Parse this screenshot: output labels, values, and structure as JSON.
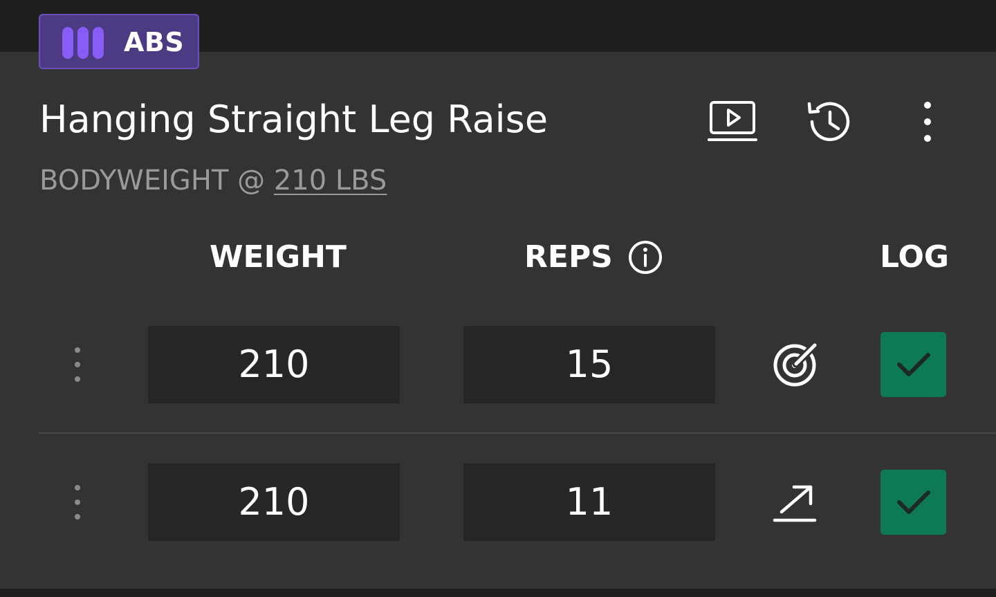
{
  "muscle_badge": {
    "label": "ABS",
    "icon": "bars-icon",
    "color": "#4c3a82",
    "accent": "#8a5cf6"
  },
  "exercise": {
    "title": "Hanging Straight Leg Raise",
    "subtitle_prefix": "BODYWEIGHT @ ",
    "subtitle_weight": "210 LBS"
  },
  "header_actions": {
    "video_icon": "play-video-icon",
    "history_icon": "history-icon",
    "more_icon": "more-vertical-icon"
  },
  "columns": {
    "weight": "WEIGHT",
    "reps": "REPS",
    "reps_info_icon": "info-icon",
    "log": "LOG"
  },
  "sets": [
    {
      "weight": "210",
      "reps": "15",
      "status_icon": "target-icon",
      "logged": true
    },
    {
      "weight": "210",
      "reps": "11",
      "status_icon": "trend-up-icon",
      "logged": true
    }
  ],
  "colors": {
    "background": "#333333",
    "cell": "#262626",
    "log_checked": "#0e7a55"
  }
}
